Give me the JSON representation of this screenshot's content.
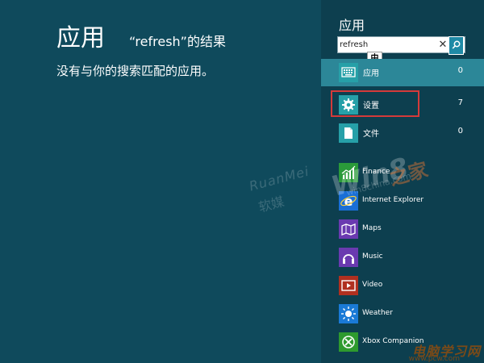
{
  "results": {
    "title": "应用",
    "query": "“refresh”的结果",
    "no_results": "没有与你的搜索匹配的应用。"
  },
  "panel": {
    "title": "应用",
    "search": {
      "value": "refresh",
      "ime_label": "中"
    },
    "categories": [
      {
        "label": "应用",
        "count": "0",
        "icon": "keyboard-icon",
        "selected": true
      },
      {
        "label": "设置",
        "count": "7",
        "icon": "gear-icon",
        "selected": false
      },
      {
        "label": "文件",
        "count": "0",
        "icon": "document-icon",
        "selected": false
      }
    ],
    "apps": [
      {
        "label": "Finance",
        "icon": "finance-icon",
        "color": "#2a9a3a"
      },
      {
        "label": "Internet Explorer",
        "icon": "internet-explorer-icon",
        "color": "#1a6fd6"
      },
      {
        "label": "Maps",
        "icon": "maps-icon",
        "color": "#6a3ab0"
      },
      {
        "label": "Music",
        "icon": "music-icon",
        "color": "#6a3ab0"
      },
      {
        "label": "Video",
        "icon": "video-icon",
        "color": "#b03020"
      },
      {
        "label": "Weather",
        "icon": "weather-icon",
        "color": "#1a7ad6"
      },
      {
        "label": "Xbox Companion",
        "icon": "xbox-icon",
        "color": "#2e9a2e"
      }
    ]
  },
  "watermarks": {
    "left_logo": "RuanMei",
    "left_sub": "软媒",
    "center_logo": "Win8",
    "center_sub": "win8china.com",
    "center_suffix": "之家",
    "corner": "电脑学习网",
    "corner_sub": "www.pcw.com"
  },
  "colors": {
    "background": "#0f4a5c",
    "panel": "#0d3f4f",
    "selected_row": "#2c8798",
    "highlight_border": "#d53a3a"
  }
}
